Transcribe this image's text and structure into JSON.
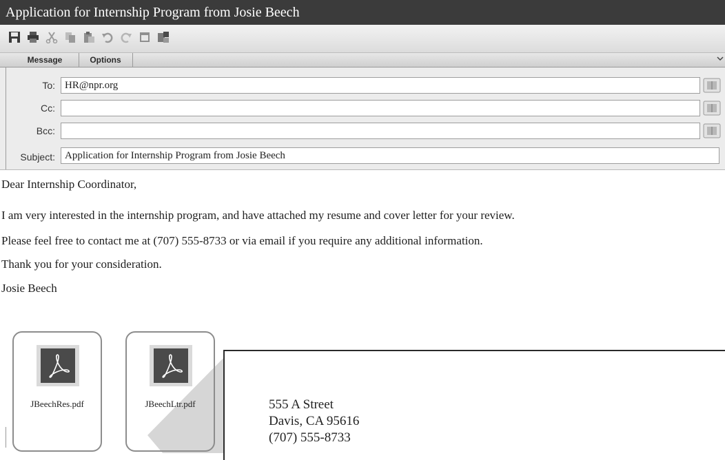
{
  "window": {
    "title": "Application for Internship Program from Josie Beech"
  },
  "toolbar": {
    "icons": [
      "save-icon",
      "print-icon",
      "cut-icon",
      "copy-icon",
      "paste-icon",
      "undo-icon",
      "redo-icon",
      "calendar-icon",
      "attach-icon"
    ]
  },
  "tabs": [
    {
      "label": "Message"
    },
    {
      "label": "Options"
    }
  ],
  "header": {
    "to": {
      "label": "To:",
      "value": "HR@npr.org"
    },
    "cc": {
      "label": "Cc:",
      "value": ""
    },
    "bcc": {
      "label": "Bcc:",
      "value": ""
    },
    "subject": {
      "label": "Subject:",
      "value": "Application for Internship Program from Josie Beech"
    }
  },
  "body": {
    "lines": [
      "Dear Internship Coordinator,",
      "I am very interested in the internship program, and have attached my resume and cover letter for your review.",
      "Please feel free to contact me at (707) 555-8733 or via email if you require any additional information.",
      "Thank you for your consideration.",
      "Josie Beech"
    ]
  },
  "attachments": [
    {
      "name": "JBeechRes.pdf"
    },
    {
      "name": "JBeechLtr.pdf"
    }
  ],
  "letter_preview": {
    "lines": [
      "555 A Street",
      "Davis, CA  95616",
      "(707) 555-8733"
    ]
  },
  "colors": {
    "titlebar": "#3b3b3b",
    "header_bg": "#ececec",
    "pdf_icon": "#4a4a4a"
  }
}
